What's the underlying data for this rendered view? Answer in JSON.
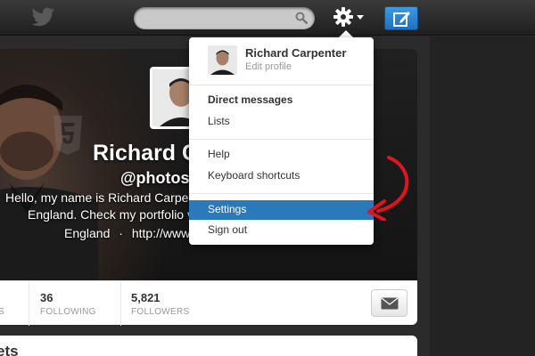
{
  "header": {
    "search": {
      "value": "",
      "placeholder": ""
    },
    "icons": [
      "twitter-bird-icon",
      "search-icon",
      "gear-icon",
      "chevron-down-icon",
      "compose-icon"
    ],
    "colors": {
      "compose_button": "#2a87d8",
      "menu_highlight": "#2a79b8",
      "annotation_arrow": "#e0141e"
    }
  },
  "profile": {
    "name": "Richard C",
    "handle": "@photosh",
    "bio_line1": "Hello, my name is Richard Carpe",
    "bio_line2": "England. Check my portfolio v",
    "location": "England",
    "location_separator": "·",
    "url": "http://www.r"
  },
  "stats": {
    "partial_label": "S",
    "following": {
      "count": "36",
      "label": "FOLLOWING"
    },
    "followers": {
      "count": "5,821",
      "label": "FOLLOWERS"
    }
  },
  "tweets": {
    "title": "ets"
  },
  "menu": {
    "user_name": "Richard Carpenter",
    "edit_profile": "Edit profile",
    "items": [
      {
        "label": "Direct messages",
        "bold": true
      },
      {
        "label": "Lists"
      },
      {
        "label": "Help"
      },
      {
        "label": "Keyboard shortcuts"
      },
      {
        "label": "Settings",
        "highlighted": true
      },
      {
        "label": "Sign out"
      }
    ]
  }
}
